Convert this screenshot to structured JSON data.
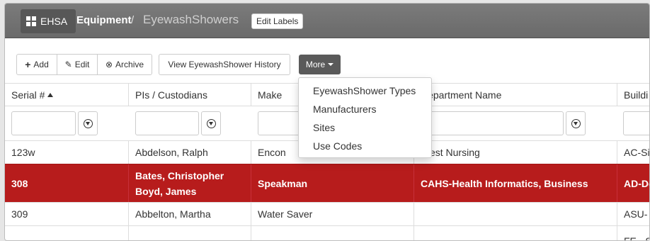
{
  "header": {
    "brand": "EHSA",
    "breadcrumb_section": "Equipment",
    "breadcrumb_sep": "/",
    "breadcrumb_page": "EyewashShowers",
    "edit_labels": "Edit Labels"
  },
  "toolbar": {
    "add": "Add",
    "edit": "Edit",
    "archive": "Archive",
    "history": "View EyewashShower History",
    "more": "More"
  },
  "more_menu": [
    "EyewashShower Types",
    "Manufacturers",
    "Sites",
    "Use Codes"
  ],
  "table": {
    "columns": [
      "Serial #",
      "PIs / Custodians",
      "Make",
      "Department Name",
      "Buildi"
    ],
    "rows": [
      {
        "serial": "123w",
        "custodians": [
          "Abdelson, Ralph"
        ],
        "make": "Encon",
        "department": "West Nursing",
        "building": "AC-Si"
      },
      {
        "serial": "308",
        "custodians": [
          "Bates, Christopher",
          "Boyd, James"
        ],
        "make": "Speakman",
        "department": "CAHS-Health Informatics, Business",
        "building": "AD-De"
      },
      {
        "serial": "309",
        "custodians": [
          "Abbelton, Martha"
        ],
        "make": "Water Saver",
        "department": "",
        "building": "ASU-"
      },
      {
        "serial": "",
        "custodians": [
          ""
        ],
        "make": "",
        "department": "",
        "building": "FE - S"
      }
    ]
  },
  "colors": {
    "selected_row": "#b71c1c",
    "topbar": "#6f6f6f",
    "more_button": "#5a5a5a"
  }
}
